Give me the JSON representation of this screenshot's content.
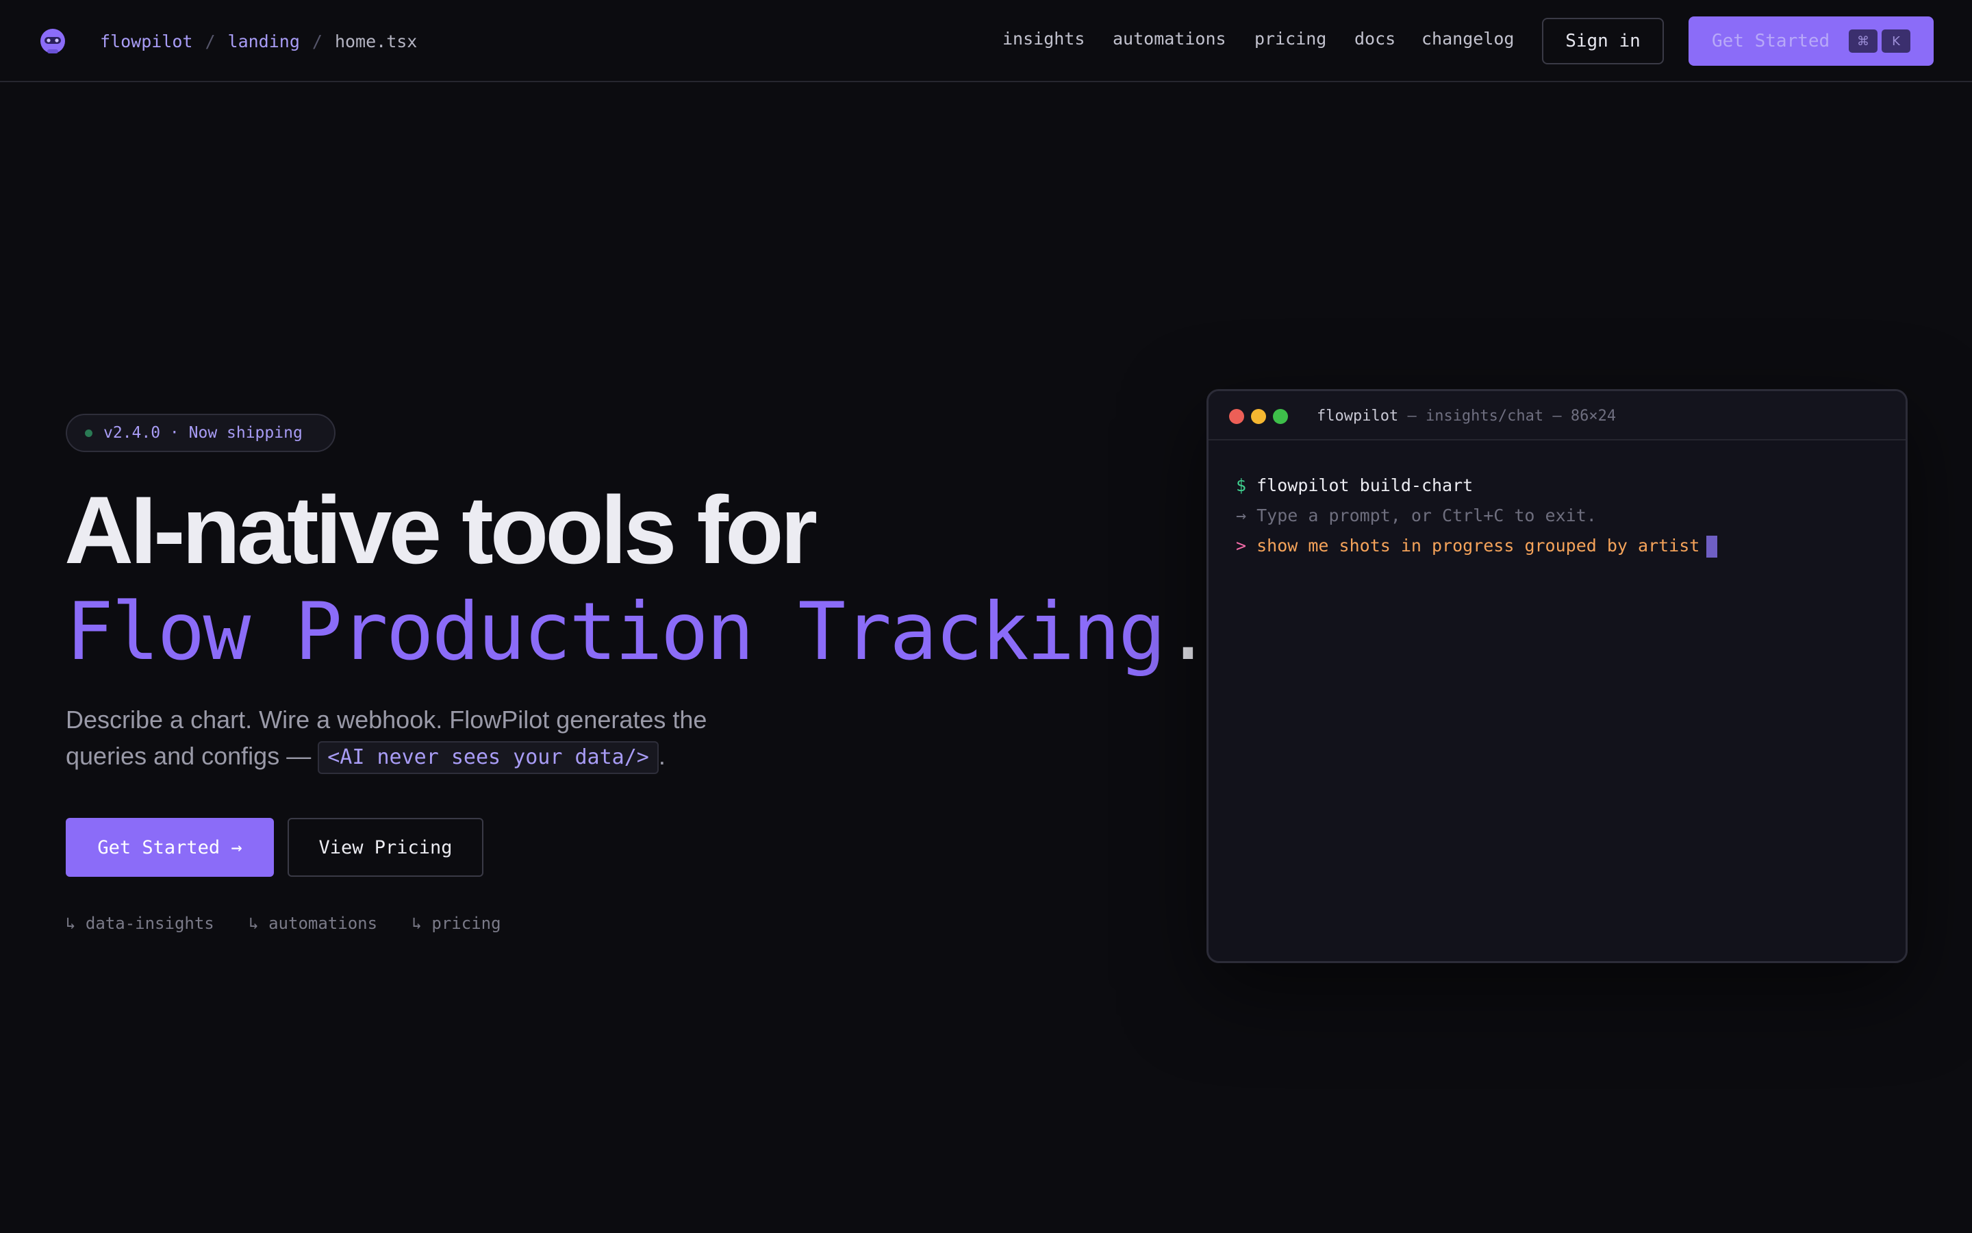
{
  "breadcrumb": {
    "org": "flowpilot",
    "project": "landing",
    "file": "home.tsx",
    "separator": "/"
  },
  "nav": {
    "links": [
      "insights",
      "automations",
      "pricing",
      "docs",
      "changelog"
    ],
    "sign_in": "Sign in",
    "get_started": "Get Started",
    "kbd_mod": "⌘",
    "kbd_key": "K"
  },
  "hero": {
    "badge": "v2.4.0 · Now shipping",
    "headline_line1": "AI-native tools for",
    "headline_line2": "Flow Production Tracking",
    "headline_dot": ".",
    "subtitle_text": "Describe a chart. Wire a webhook. FlowPilot generates the queries and configs — ",
    "subtitle_code": "<AI never sees your data/>",
    "subtitle_end": ".",
    "primary_cta": "Get Started →",
    "secondary_cta": "View Pricing",
    "quick_links": [
      "↳ data-insights",
      "↳ automations",
      "↳ pricing"
    ]
  },
  "terminal": {
    "title_app": "flowpilot",
    "title_rest": " — insights/chat — 86×24",
    "line1_prompt": "$",
    "line1_cmd": "flowpilot build-chart",
    "line2_hint": "→ Type a prompt, or Ctrl+C to exit.",
    "line3_prompt": ">",
    "line3_query": "show me shots in progress grouped by artist"
  },
  "colors": {
    "background": "#0c0c10",
    "accent": "#8b6cf8",
    "traffic_red": "#ed5f57",
    "traffic_yellow": "#f5b731",
    "traffic_green": "#3ebf4a",
    "prompt_green": "#3fcf8e",
    "prompt_pink": "#f26ba8",
    "query_orange": "#f5a35a"
  },
  "icons": {
    "logo": "robot-head-icon",
    "status_dot": "status-dot-icon"
  }
}
